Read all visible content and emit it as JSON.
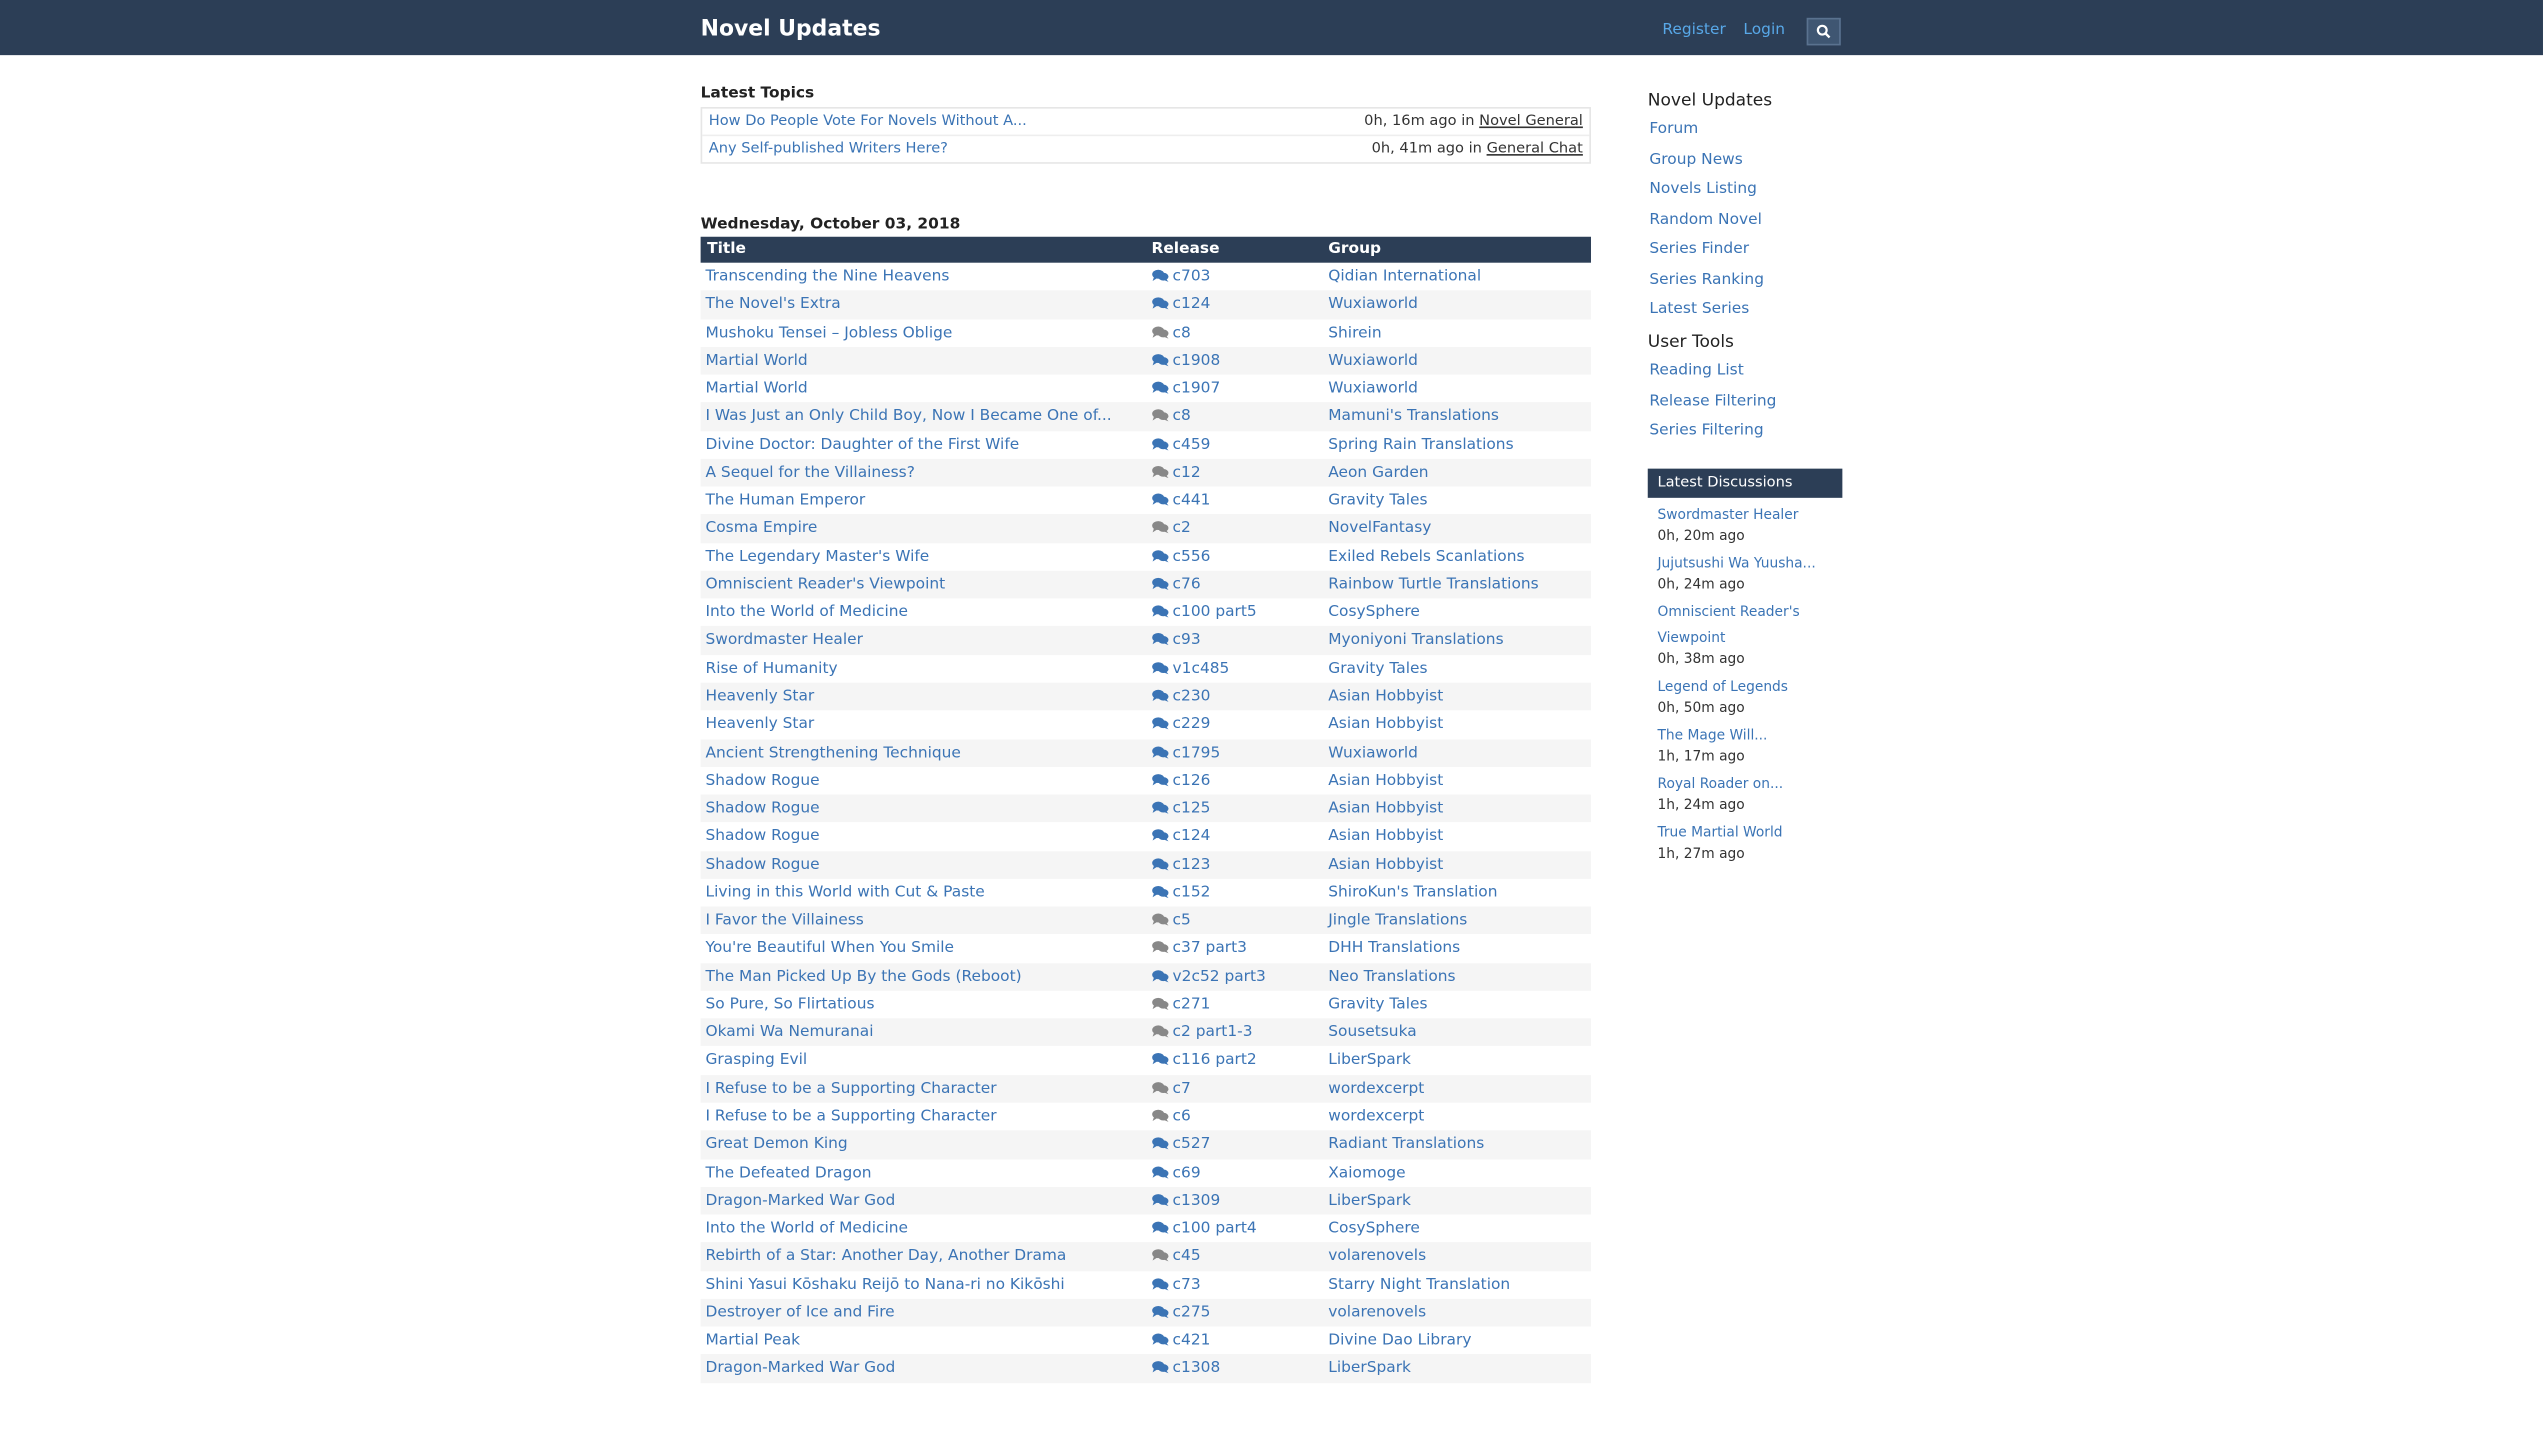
{
  "header": {
    "brand": "Novel Updates",
    "register": "Register",
    "login": "Login"
  },
  "latest_topics": {
    "heading": "Latest Topics",
    "items": [
      {
        "title": "How Do People Vote For Novels Without A...",
        "time": "0h, 16m ago in ",
        "forum": "Novel General"
      },
      {
        "title": "Any Self-published Writers Here?",
        "time": "0h, 41m ago in ",
        "forum": "General Chat"
      }
    ]
  },
  "releases": {
    "date": "Wednesday, October 03, 2018",
    "columns": {
      "title": "Title",
      "release": "Release",
      "group": "Group"
    },
    "rows": [
      {
        "title": "Transcending the Nine Heavens",
        "release": "c703",
        "group": "Qidian International",
        "read": true
      },
      {
        "title": "The Novel's Extra",
        "release": "c124",
        "group": "Wuxiaworld",
        "read": true
      },
      {
        "title": "Mushoku Tensei – Jobless Oblige",
        "release": "c8",
        "group": "Shirein",
        "read": false
      },
      {
        "title": "Martial World",
        "release": "c1908",
        "group": "Wuxiaworld",
        "read": true
      },
      {
        "title": "Martial World",
        "release": "c1907",
        "group": "Wuxiaworld",
        "read": true
      },
      {
        "title": "I Was Just an Only Child Boy, Now I Became One of...",
        "release": "c8",
        "group": "Mamuni's Translations",
        "read": false
      },
      {
        "title": "Divine Doctor: Daughter of the First Wife",
        "release": "c459",
        "group": "Spring Rain Translations",
        "read": true
      },
      {
        "title": "A Sequel for the Villainess?",
        "release": "c12",
        "group": "Aeon Garden",
        "read": false
      },
      {
        "title": "The Human Emperor",
        "release": "c441",
        "group": "Gravity Tales",
        "read": true
      },
      {
        "title": "Cosma Empire",
        "release": "c2",
        "group": "NovelFantasy",
        "read": false
      },
      {
        "title": "The Legendary Master's Wife",
        "release": "c556",
        "group": "Exiled Rebels Scanlations",
        "read": true
      },
      {
        "title": "Omniscient Reader's Viewpoint",
        "release": "c76",
        "group": "Rainbow Turtle Translations",
        "read": true
      },
      {
        "title": "Into the World of Medicine",
        "release": "c100 part5",
        "group": "CosySphere",
        "read": true
      },
      {
        "title": "Swordmaster Healer",
        "release": "c93",
        "group": "Myoniyoni Translations",
        "read": true
      },
      {
        "title": "Rise of Humanity",
        "release": "v1c485",
        "group": "Gravity Tales",
        "read": true
      },
      {
        "title": "Heavenly Star",
        "release": "c230",
        "group": "Asian Hobbyist",
        "read": true
      },
      {
        "title": "Heavenly Star",
        "release": "c229",
        "group": "Asian Hobbyist",
        "read": true
      },
      {
        "title": "Ancient Strengthening Technique",
        "release": "c1795",
        "group": "Wuxiaworld",
        "read": true
      },
      {
        "title": "Shadow Rogue",
        "release": "c126",
        "group": "Asian Hobbyist",
        "read": true
      },
      {
        "title": "Shadow Rogue",
        "release": "c125",
        "group": "Asian Hobbyist",
        "read": true
      },
      {
        "title": "Shadow Rogue",
        "release": "c124",
        "group": "Asian Hobbyist",
        "read": true
      },
      {
        "title": "Shadow Rogue",
        "release": "c123",
        "group": "Asian Hobbyist",
        "read": true
      },
      {
        "title": "Living in this World with Cut & Paste",
        "release": "c152",
        "group": "ShiroKun's Translation",
        "read": true
      },
      {
        "title": "I Favor the Villainess",
        "release": "c5",
        "group": "Jingle Translations",
        "read": false
      },
      {
        "title": "You're Beautiful When You Smile",
        "release": "c37 part3",
        "group": "DHH Translations",
        "read": false
      },
      {
        "title": "The Man Picked Up By the Gods (Reboot)",
        "release": "v2c52 part3",
        "group": "Neo Translations",
        "read": true
      },
      {
        "title": "So Pure, So Flirtatious",
        "release": "c271",
        "group": "Gravity Tales",
        "read": false
      },
      {
        "title": "Okami Wa Nemuranai",
        "release": "c2 part1-3",
        "group": "Sousetsuka",
        "read": false
      },
      {
        "title": "Grasping Evil",
        "release": "c116 part2",
        "group": "LiberSpark",
        "read": true
      },
      {
        "title": "I Refuse to be a Supporting Character",
        "release": "c7",
        "group": "wordexcerpt",
        "read": false
      },
      {
        "title": "I Refuse to be a Supporting Character",
        "release": "c6",
        "group": "wordexcerpt",
        "read": false
      },
      {
        "title": "Great Demon King",
        "release": "c527",
        "group": "Radiant Translations",
        "read": true
      },
      {
        "title": "The Defeated Dragon",
        "release": "c69",
        "group": "Xaiomoge",
        "read": true
      },
      {
        "title": "Dragon-Marked War God",
        "release": "c1309",
        "group": "LiberSpark",
        "read": true
      },
      {
        "title": "Into the World of Medicine",
        "release": "c100 part4",
        "group": "CosySphere",
        "read": true
      },
      {
        "title": "Rebirth of a Star: Another Day, Another Drama",
        "release": "c45",
        "group": "volarenovels",
        "read": false
      },
      {
        "title": "Shini Yasui Kōshaku Reijō to Nana-ri no Kikōshi",
        "release": "c73",
        "group": "Starry Night Translation",
        "read": true
      },
      {
        "title": "Destroyer of Ice and Fire",
        "release": "c275",
        "group": "volarenovels",
        "read": true
      },
      {
        "title": "Martial Peak",
        "release": "c421",
        "group": "Divine Dao Library",
        "read": true
      },
      {
        "title": "Dragon-Marked War God",
        "release": "c1308",
        "group": "LiberSpark",
        "read": true
      }
    ]
  },
  "sidebar": {
    "site_heading": "Novel Updates",
    "site_links": [
      "Forum",
      "Group News",
      "Novels Listing",
      "Random Novel",
      "Series Finder",
      "Series Ranking",
      "Latest Series"
    ],
    "tools_heading": "User Tools",
    "tool_links": [
      "Reading List",
      "Release Filtering",
      "Series Filtering"
    ],
    "discussions_heading": "Latest Discussions",
    "discussions": [
      {
        "title": "Swordmaster Healer",
        "time": "0h, 20m ago"
      },
      {
        "title": "Jujutsushi Wa Yuusha...",
        "time": "0h, 24m ago"
      },
      {
        "title": "Omniscient Reader's Viewpoint",
        "time": "0h, 38m ago"
      },
      {
        "title": "Legend of Legends",
        "time": "0h, 50m ago"
      },
      {
        "title": "The Mage Will...",
        "time": "1h, 17m ago"
      },
      {
        "title": "Royal Roader on...",
        "time": "1h, 24m ago"
      },
      {
        "title": "True Martial World",
        "time": "1h, 27m ago"
      }
    ]
  },
  "colors": {
    "nav_bg": "#2c3e56",
    "link": "#3b74b5",
    "chat_active": "#3b74b5",
    "chat_inactive": "#888888"
  }
}
